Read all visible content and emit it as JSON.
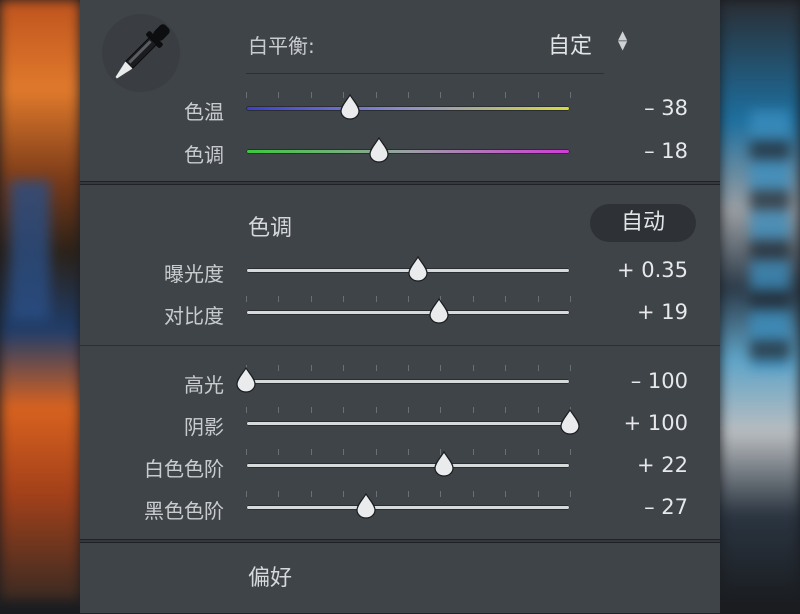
{
  "white_balance": {
    "label": "白平衡:",
    "value": "自定",
    "arrows_icon": "updown-chevron-icon",
    "dropper_icon": "eyedropper-icon",
    "sliders": [
      {
        "label": "色温",
        "value": "– 38",
        "position": 0.32,
        "track": "temp"
      },
      {
        "label": "色调",
        "value": "– 18",
        "position": 0.41,
        "track": "tint"
      }
    ]
  },
  "tone": {
    "title": "色调",
    "auto_label": "自动",
    "sliders": [
      {
        "label": "曝光度",
        "value": "+ 0.35",
        "position": 0.53
      },
      {
        "label": "对比度",
        "value": "+ 19",
        "position": 0.595
      },
      {
        "label": "高光",
        "value": "– 100",
        "position": 0.0
      },
      {
        "label": "阴影",
        "value": "+ 100",
        "position": 1.0
      },
      {
        "label": "白色色阶",
        "value": "+ 22",
        "position": 0.61
      },
      {
        "label": "黑色色阶",
        "value": "– 27",
        "position": 0.37
      }
    ]
  },
  "preference": {
    "title": "偏好"
  },
  "colors": {
    "panel_bg": "#3f4449",
    "temp_gradient": [
      "#3b3fd0",
      "#d8dc3a"
    ],
    "tint_gradient": [
      "#3cc83c",
      "#d23cd8"
    ]
  }
}
